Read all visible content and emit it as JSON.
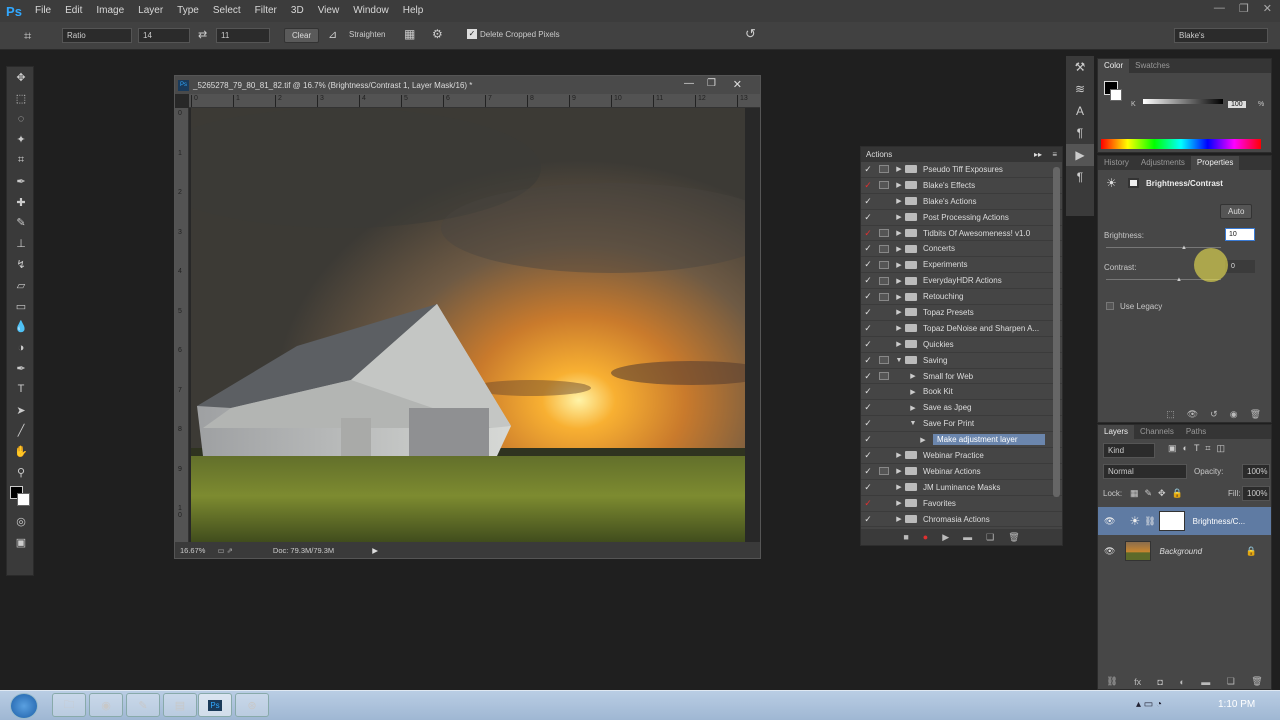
{
  "app": {
    "logo": "Ps",
    "window_controls": [
      "—",
      "❐",
      "✕"
    ]
  },
  "menu": [
    "File",
    "Edit",
    "Image",
    "Layer",
    "Type",
    "Select",
    "Filter",
    "3D",
    "View",
    "Window",
    "Help"
  ],
  "options": {
    "ratio": "Ratio",
    "width": "14",
    "height": "11",
    "clear": "Clear",
    "straighten": "Straighten",
    "delete_cropped": "Delete Cropped Pixels",
    "workspace": "Blake's"
  },
  "document": {
    "title": "_5265278_79_80_81_82.tif @ 16.7% (Brightness/Contrast 1, Layer Mask/16) *",
    "zoom": "16.67%",
    "doc_size": "Doc: 79.3M/79.3M",
    "ruler_h": [
      "0",
      "1",
      "2",
      "3",
      "4",
      "5",
      "6",
      "7",
      "8",
      "9",
      "10",
      "11",
      "12",
      "13"
    ],
    "ruler_v": [
      "0",
      "1",
      "2",
      "3",
      "4",
      "5",
      "6",
      "7",
      "8",
      "9",
      "1\n0",
      "1\n1"
    ]
  },
  "actions": {
    "title": "Actions",
    "rows": [
      {
        "label": "Pseudo Tiff Exposures",
        "red": false,
        "box": true,
        "level": 0,
        "open": false,
        "folder": true
      },
      {
        "label": "Blake's Effects",
        "red": true,
        "box": true,
        "level": 0,
        "open": false,
        "folder": true
      },
      {
        "label": "Blake's Actions",
        "red": false,
        "box": false,
        "level": 0,
        "open": false,
        "folder": true
      },
      {
        "label": "Post Processing Actions",
        "red": false,
        "box": false,
        "level": 0,
        "open": false,
        "folder": true
      },
      {
        "label": "Tidbits Of Awesomeness! v1.0",
        "red": true,
        "box": true,
        "level": 0,
        "open": false,
        "folder": true
      },
      {
        "label": "Concerts",
        "red": false,
        "box": true,
        "level": 0,
        "open": false,
        "folder": true
      },
      {
        "label": "Experiments",
        "red": false,
        "box": true,
        "level": 0,
        "open": false,
        "folder": true
      },
      {
        "label": "EverydayHDR Actions",
        "red": false,
        "box": true,
        "level": 0,
        "open": false,
        "folder": true
      },
      {
        "label": "Retouching",
        "red": false,
        "box": true,
        "level": 0,
        "open": false,
        "folder": true
      },
      {
        "label": "Topaz Presets",
        "red": false,
        "box": false,
        "level": 0,
        "open": false,
        "folder": true
      },
      {
        "label": "Topaz DeNoise and Sharpen A...",
        "red": false,
        "box": false,
        "level": 0,
        "open": false,
        "folder": true
      },
      {
        "label": "Quickies",
        "red": false,
        "box": false,
        "level": 0,
        "open": false,
        "folder": true
      },
      {
        "label": "Saving",
        "red": false,
        "box": true,
        "level": 0,
        "open": true,
        "folder": true
      },
      {
        "label": "Small for Web",
        "red": false,
        "box": true,
        "level": 1,
        "open": false,
        "folder": false
      },
      {
        "label": "Book Kit",
        "red": false,
        "box": false,
        "level": 1,
        "open": false,
        "folder": false
      },
      {
        "label": "Save as Jpeg",
        "red": false,
        "box": false,
        "level": 1,
        "open": false,
        "folder": false
      },
      {
        "label": "Save For Print",
        "red": false,
        "box": false,
        "level": 1,
        "open": true,
        "folder": false
      },
      {
        "label": "Make adjustment layer",
        "red": false,
        "box": false,
        "level": 2,
        "open": false,
        "folder": false,
        "selected": true
      },
      {
        "label": "Webinar Practice",
        "red": false,
        "box": false,
        "level": 0,
        "open": false,
        "folder": true
      },
      {
        "label": "Webinar Actions",
        "red": false,
        "box": true,
        "level": 0,
        "open": false,
        "folder": true
      },
      {
        "label": "JM Luminance Masks",
        "red": false,
        "box": false,
        "level": 0,
        "open": false,
        "folder": true
      },
      {
        "label": "Favorites",
        "red": true,
        "box": false,
        "level": 0,
        "open": false,
        "folder": true
      },
      {
        "label": "Chromasia Actions",
        "red": false,
        "box": false,
        "level": 0,
        "open": false,
        "folder": true
      }
    ]
  },
  "color_panel": {
    "tabs": [
      "Color",
      "Swatches"
    ],
    "channel": "K",
    "value": "100",
    "unit": "%"
  },
  "properties": {
    "tabs": [
      "History",
      "Adjustments",
      "Properties"
    ],
    "heading": "Brightness/Contrast",
    "auto": "Auto",
    "brightness_label": "Brightness:",
    "brightness_value": "10",
    "contrast_label": "Contrast:",
    "contrast_value": "0",
    "legacy": "Use Legacy"
  },
  "layers": {
    "tabs": [
      "Layers",
      "Channels",
      "Paths"
    ],
    "kind": "Kind",
    "blend": "Normal",
    "opacity_label": "Opacity:",
    "opacity": "100%",
    "lock_label": "Lock:",
    "fill_label": "Fill:",
    "fill": "100%",
    "items": [
      {
        "name": "Brightness/C...",
        "selected": true
      },
      {
        "name": "Background",
        "selected": false
      }
    ]
  },
  "taskbar": {
    "time": "1:10 PM"
  }
}
